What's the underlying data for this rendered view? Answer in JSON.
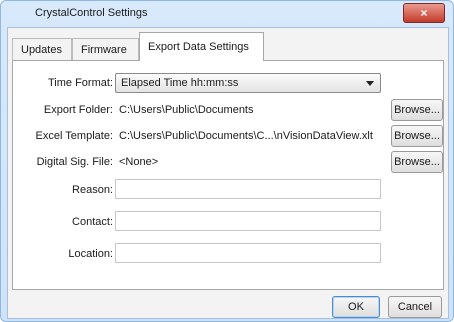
{
  "window": {
    "title": "CrystalControl Settings",
    "close_label": "×"
  },
  "tabs": [
    {
      "label": "Updates"
    },
    {
      "label": "Firmware"
    },
    {
      "label": "Export Data Settings"
    }
  ],
  "fields": {
    "time_format": {
      "label": "Time Format:",
      "value": "Elapsed Time hh:mm:ss"
    },
    "export_folder": {
      "label": "Export Folder:",
      "value": "C:\\Users\\Public\\Documents",
      "button": "Browse..."
    },
    "excel_template": {
      "label": "Excel Template:",
      "value": "C:\\Users\\Public\\Documents\\C...\\nVisionDataView.xlt",
      "button": "Browse..."
    },
    "digital_sig": {
      "label": "Digital Sig. File:",
      "value": "<None>",
      "button": "Browse..."
    },
    "reason": {
      "label": "Reason:",
      "value": ""
    },
    "contact": {
      "label": "Contact:",
      "value": ""
    },
    "location": {
      "label": "Location:",
      "value": ""
    }
  },
  "footer": {
    "ok": "OK",
    "cancel": "Cancel"
  }
}
